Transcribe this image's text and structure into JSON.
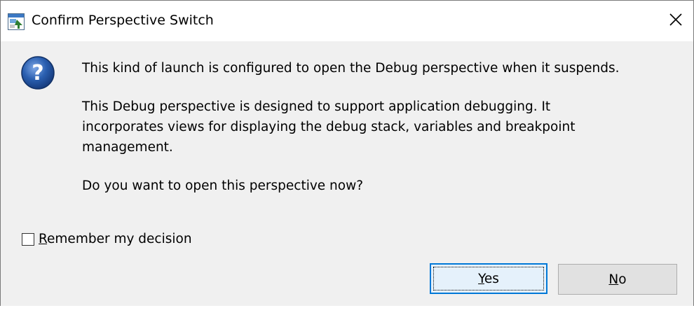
{
  "window": {
    "title": "Confirm Perspective Switch",
    "close_icon": "close-icon",
    "title_icon": "eclipse-window-icon"
  },
  "content": {
    "icon": "question-icon",
    "paragraph1": "This kind of launch is configured to open the Debug perspective when it suspends.",
    "paragraph2_line1": "This Debug perspective is designed to support application debugging.  It",
    "paragraph2_line2": "incorporates views for displaying the debug stack, variables and breakpoint",
    "paragraph2_line3": "management.",
    "paragraph3": "Do you want to open this perspective now?"
  },
  "remember": {
    "mnemonic": "R",
    "rest": "emember my decision",
    "checked": false
  },
  "buttons": {
    "yes_mnemonic": "Y",
    "yes_rest": "es",
    "no_mnemonic": "N",
    "no_rest": "o"
  },
  "colors": {
    "accent": "#0078d7",
    "dialog_bg": "#f0f0f0",
    "titlebar_bg": "#ffffff",
    "question_icon": "#2a5fb0"
  }
}
